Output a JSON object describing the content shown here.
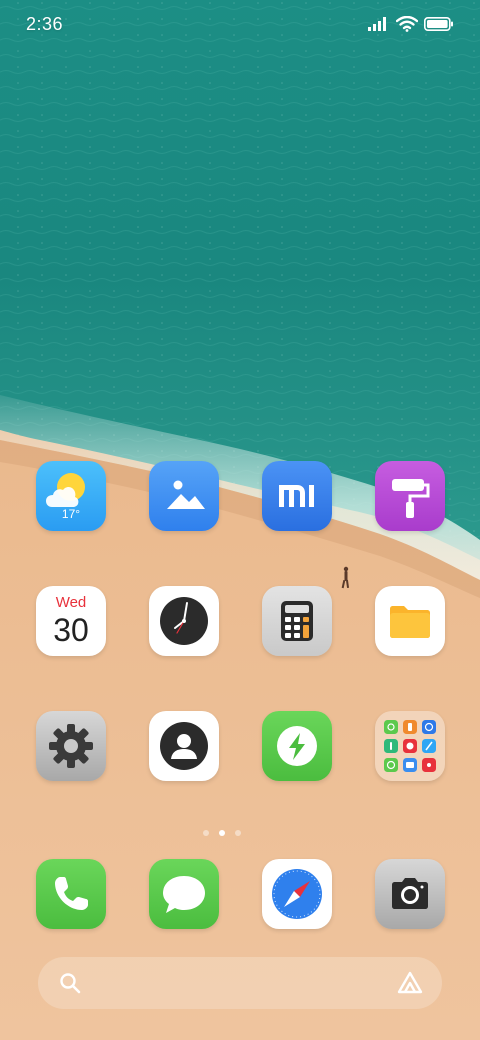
{
  "status_bar": {
    "time": "2:36",
    "icons": [
      "cellular-signal-icon",
      "wifi-icon",
      "battery-icon"
    ]
  },
  "home_screen": {
    "rows": [
      [
        {
          "name": "weather-app",
          "icon": "weather-sun-cloud-icon",
          "text": "17°"
        },
        {
          "name": "gallery-app",
          "icon": "gallery-mountain-icon"
        },
        {
          "name": "mi-app",
          "icon": "mi-logo-icon"
        },
        {
          "name": "themes-app",
          "icon": "paint-roller-icon"
        }
      ],
      [
        {
          "name": "calendar-app",
          "icon": "calendar-icon",
          "day": "Wed",
          "date": "30"
        },
        {
          "name": "clock-app",
          "icon": "clock-icon"
        },
        {
          "name": "calculator-app",
          "icon": "calculator-icon"
        },
        {
          "name": "file-manager-app",
          "icon": "folder-icon"
        }
      ],
      [
        {
          "name": "settings-app",
          "icon": "gear-icon"
        },
        {
          "name": "contacts-app",
          "icon": "contact-person-icon"
        },
        {
          "name": "security-app",
          "icon": "lightning-bolt-icon"
        },
        {
          "name": "app-folder",
          "icon": "folder-grid-icon"
        }
      ]
    ],
    "page_indicator": {
      "count": 3,
      "active": 1
    }
  },
  "dock": [
    {
      "name": "phone-app",
      "icon": "phone-handset-icon"
    },
    {
      "name": "messages-app",
      "icon": "chat-bubble-icon"
    },
    {
      "name": "browser-app",
      "icon": "compass-icon"
    },
    {
      "name": "camera-app",
      "icon": "camera-icon"
    }
  ],
  "search_bar": {
    "left_icon": "search-icon",
    "right_icon": "assistant-icon"
  },
  "colors": {
    "sea": "#1f8a86",
    "sand": "#e9b98e",
    "weather": "#2fa6f5",
    "gallery": "#3a8ef0",
    "mi": "#2e79e8",
    "themes": "#b84bd8",
    "security": "#5cc94d",
    "phone": "#5cc94d",
    "messages": "#5cc94d",
    "calendar_red": "#e8313b"
  }
}
